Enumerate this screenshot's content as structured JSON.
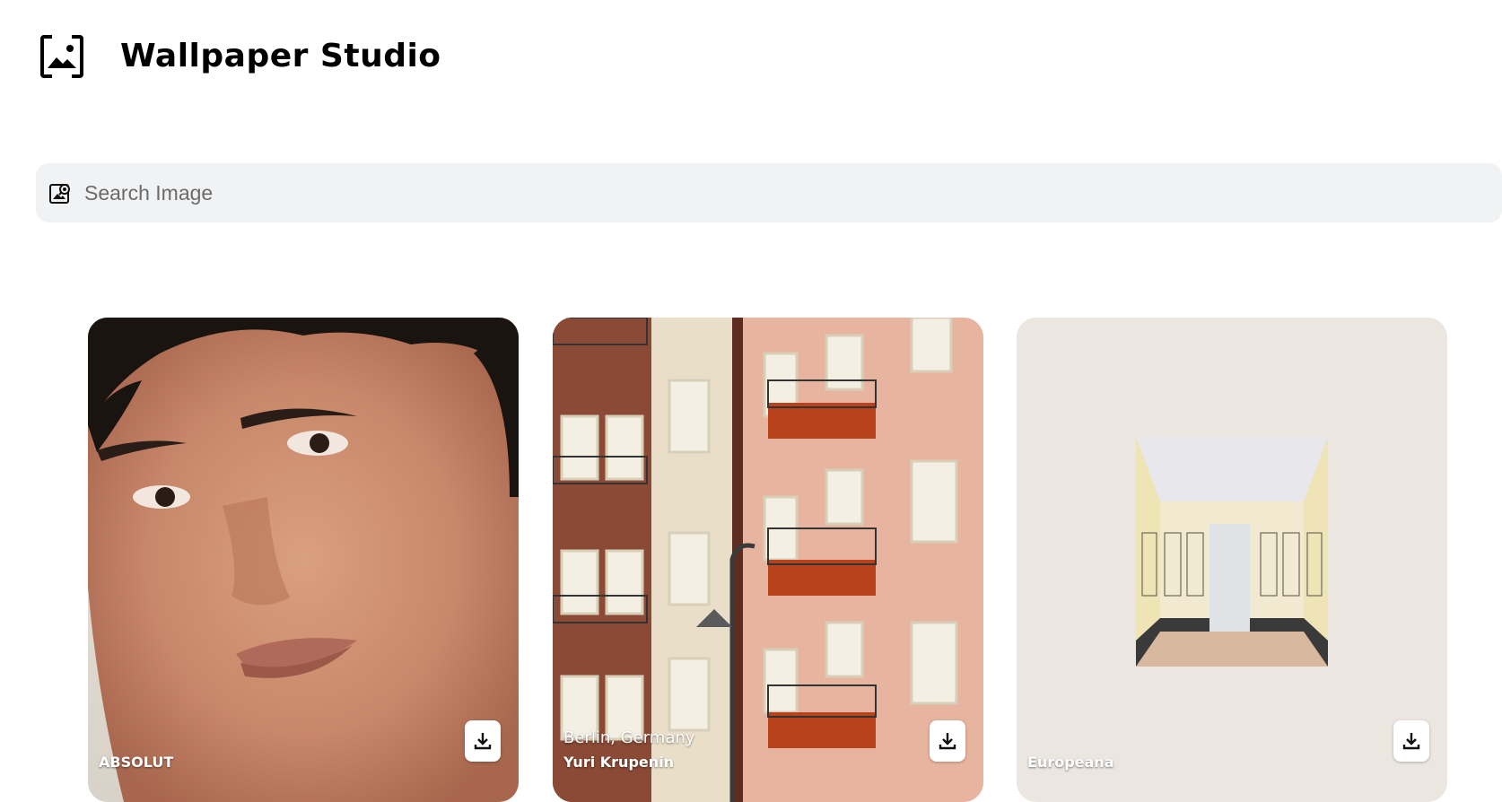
{
  "app": {
    "title": "Wallpaper Studio",
    "logo_icon": "image-frame-icon"
  },
  "search": {
    "placeholder": "Search Image",
    "value": "",
    "icon": "image-search-icon"
  },
  "cards": [
    {
      "location": "",
      "credit": "ABSOLUT",
      "download_icon": "download-icon",
      "subject": "portrait"
    },
    {
      "location": "Berlin, Germany",
      "credit": "Yuri Krupenin",
      "download_icon": "download-icon",
      "subject": "building-facade"
    },
    {
      "location": "",
      "credit": "Europeana",
      "download_icon": "download-icon",
      "subject": "interior-painting"
    }
  ],
  "colors": {
    "search_bg": "#f1f2f3",
    "text": "#000000",
    "placeholder": "#6b6b6b"
  }
}
